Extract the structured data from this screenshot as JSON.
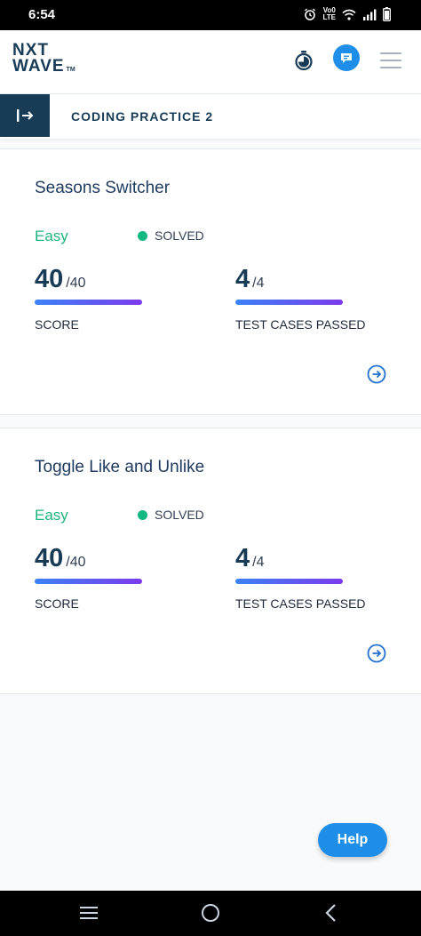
{
  "status_bar": {
    "time": "6:54",
    "net_label_top": "Vo0",
    "net_label_bottom": "LTE"
  },
  "brand": {
    "line1": "NXT",
    "line2": "WAVE",
    "tm": "TM"
  },
  "header": {
    "section_title": "CODING PRACTICE 2"
  },
  "problems": [
    {
      "title": "Seasons Switcher",
      "difficulty": "Easy",
      "status": "SOLVED",
      "score": "40",
      "score_total": "/40",
      "score_label": "SCORE",
      "tests": "4",
      "tests_total": "/4",
      "tests_label": "TEST CASES PASSED"
    },
    {
      "title": "Toggle Like and Unlike",
      "difficulty": "Easy",
      "status": "SOLVED",
      "score": "40",
      "score_total": "/40",
      "score_label": "SCORE",
      "tests": "4",
      "tests_total": "/4",
      "tests_label": "TEST CASES PASSED"
    }
  ],
  "help": {
    "label": "Help"
  },
  "colors": {
    "brand_navy": "#183b56",
    "accent_blue": "#1f8ee8",
    "easy_green": "#1fb57d",
    "solved_dot": "#10b981"
  }
}
